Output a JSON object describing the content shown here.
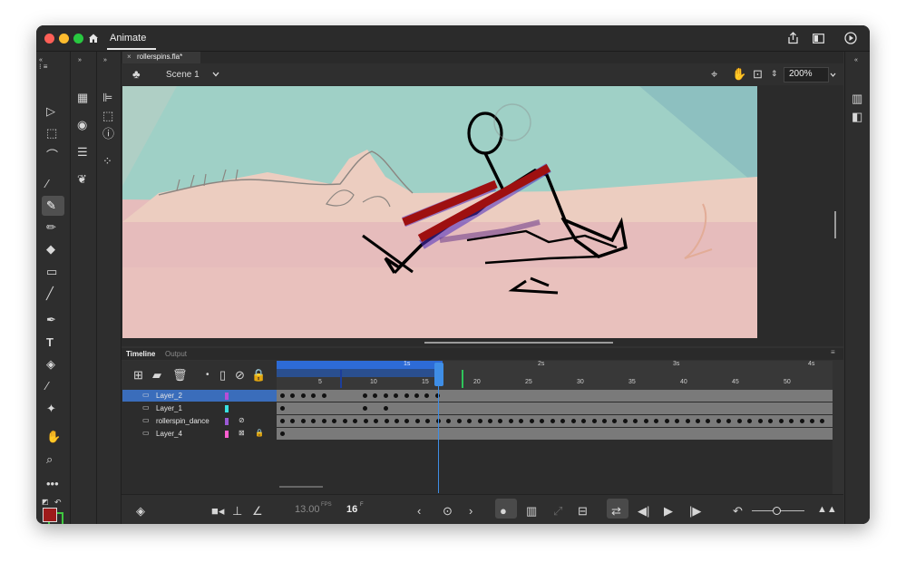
{
  "app": {
    "name": "Animate"
  },
  "document": {
    "tab_title": "rollerspins.fla*",
    "scene": "Scene 1",
    "zoom": "200%"
  },
  "timeline": {
    "tabs": [
      "Timeline",
      "Output"
    ],
    "ruler_frames": [
      "5",
      "10",
      "15",
      "20",
      "25",
      "30",
      "35",
      "40",
      "45",
      "50"
    ],
    "ruler_seconds": [
      "1s",
      "2s",
      "3s",
      "4s"
    ],
    "layers": [
      {
        "name": "Layer_2",
        "color": "#b84dd6",
        "selected": true
      },
      {
        "name": "Layer_1",
        "color": "#37e0e0",
        "selected": false
      },
      {
        "name": "rollerspin_dance",
        "color": "#9b59d6",
        "selected": false
      },
      {
        "name": "Layer_4",
        "color": "#ff5fd0",
        "selected": false
      }
    ],
    "fps_value": "13.00",
    "fps_unit": "FPS",
    "current_frame": "16",
    "frame_unit": "F"
  },
  "colors": {
    "accent": "#2d6bd6",
    "stroke": "#9e1b1b",
    "fill": "#3fc83f",
    "canvas_sky": "#9fd0c6",
    "canvas_sand": "#e6bcbc"
  }
}
